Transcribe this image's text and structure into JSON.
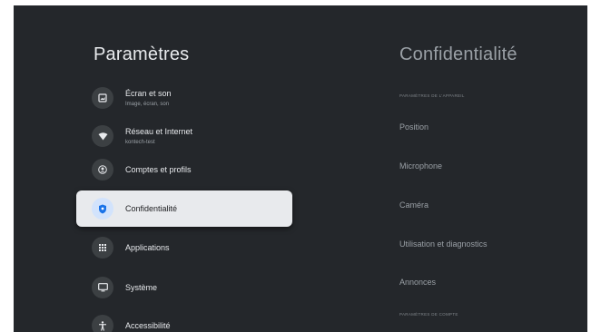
{
  "left_panel": {
    "title": "Paramètres",
    "items": [
      {
        "label": "Écran et son",
        "sub": "Image, écran, son",
        "icon": "display-icon"
      },
      {
        "label": "Réseau et Internet",
        "sub": "kontech-test",
        "icon": "wifi-icon"
      },
      {
        "label": "Comptes et profils",
        "sub": "",
        "icon": "account-icon"
      },
      {
        "label": "Confidentialité",
        "sub": "",
        "icon": "shield-icon",
        "selected": true
      },
      {
        "label": "Applications",
        "sub": "",
        "icon": "apps-grid-icon"
      },
      {
        "label": "Système",
        "sub": "",
        "icon": "monitor-icon"
      },
      {
        "label": "Accessibilité",
        "sub": "",
        "icon": "accessibility-icon"
      }
    ]
  },
  "right_panel": {
    "title": "Confidentialité",
    "section_device": "PARAMÈTRES DE L'APPAREIL",
    "items": [
      "Position",
      "Microphone",
      "Caméra",
      "Utilisation et diagnostics",
      "Annonces"
    ],
    "section_account": "PARAMÈTRES DE COMPTE"
  },
  "colors": {
    "background": "#24272b",
    "selected_bg": "#e8eaed",
    "accent": "#1a73e8"
  }
}
